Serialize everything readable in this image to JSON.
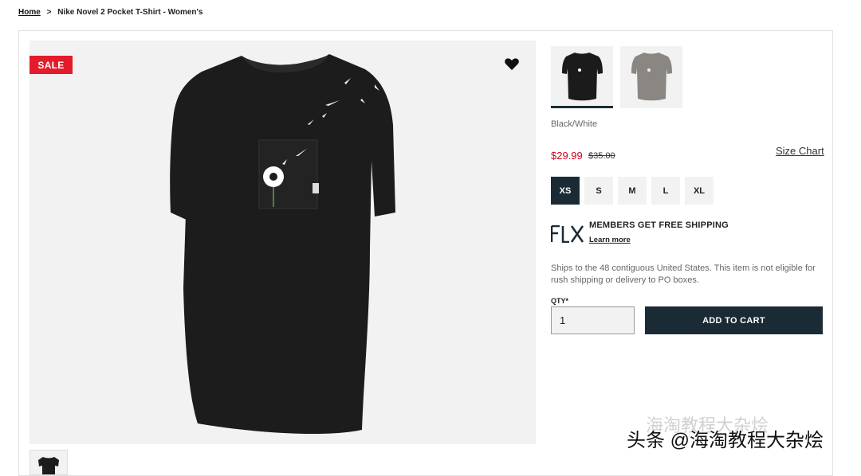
{
  "breadcrumb": {
    "home": "Home",
    "separator": ">",
    "current": "Nike Novel 2 Pocket T-Shirt - Women's"
  },
  "gallery": {
    "sale_badge": "SALE",
    "wishlist_icon": "heart-icon"
  },
  "product": {
    "color_name": "Black/White",
    "price_now": "$29.99",
    "price_was": "$35.00",
    "size_chart_label": "Size Chart",
    "sizes": [
      "XS",
      "S",
      "M",
      "L",
      "XL"
    ],
    "selected_size": "XS",
    "swatches": [
      {
        "name": "black",
        "color": "#1b1b1b"
      },
      {
        "name": "grey",
        "color": "#8a8782"
      }
    ]
  },
  "shipping": {
    "logo_text": "FLX",
    "title": "MEMBERS GET FREE SHIPPING",
    "link": "Learn more",
    "note": "Ships to the 48 contiguous United States. This item is not eligible for rush shipping or delivery to PO boxes."
  },
  "cart": {
    "qty_label": "QTY*",
    "qty_value": "1",
    "add_label": "ADD TO CART"
  },
  "watermark": {
    "top": "海淘教程大杂烩",
    "bottom": "头条 @海淘教程大杂烩"
  },
  "colors": {
    "accent_dark": "#1a2b36",
    "sale_red": "#e31b2b",
    "price_red": "#d0021b"
  }
}
